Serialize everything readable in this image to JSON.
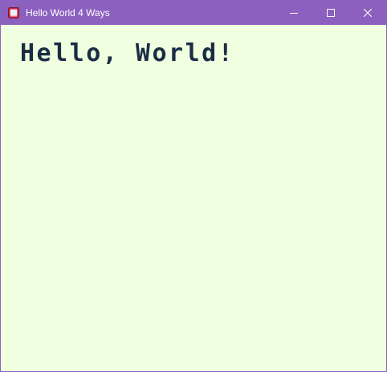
{
  "window": {
    "title": "Hello World 4 Ways",
    "title_bar_color": "#8c60be",
    "background_color": "#efffdf",
    "icons": {
      "app": "app-window-icon",
      "minimize": "minimize-icon",
      "maximize": "maximize-icon",
      "close": "close-icon"
    }
  },
  "content": {
    "greeting": "Hello, World!",
    "text_color": "#1a2d45"
  }
}
